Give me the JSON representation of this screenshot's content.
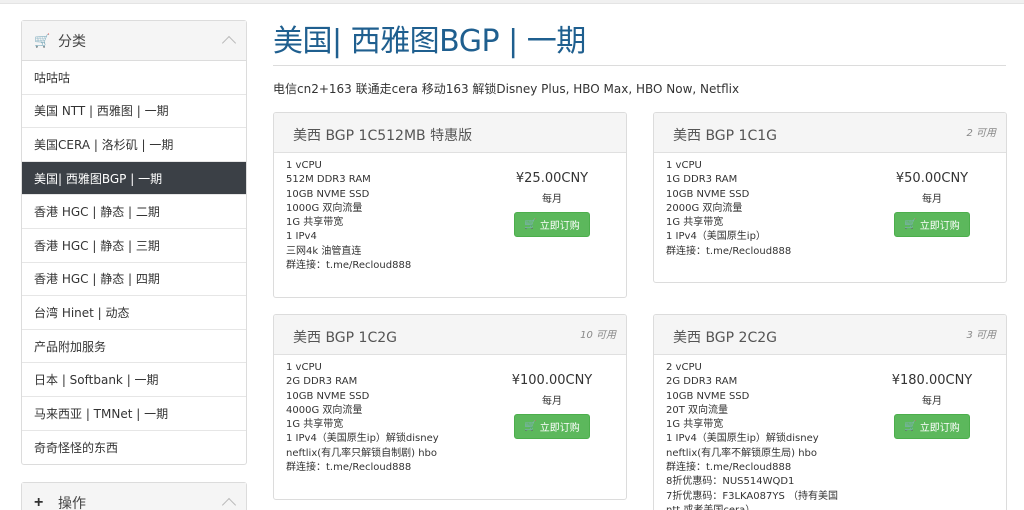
{
  "sidebar": {
    "categories": {
      "title": "分类",
      "items": [
        "咕咕咕",
        "美国 NTT | 西雅图 | 一期",
        "美国CERA | 洛杉矶 | 一期",
        "美国| 西雅图BGP | 一期",
        "香港 HGC | 静态 | 二期",
        "香港 HGC | 静态 | 三期",
        "香港 HGC | 静态 | 四期",
        "台湾 Hinet | 动态",
        "产品附加服务",
        "日本 | Softbank | 一期",
        "马来西亚 | TMNet | 一期",
        "奇奇怪怪的东西"
      ],
      "active_index": 3
    },
    "actions": {
      "title": "操作"
    }
  },
  "page": {
    "title": "美国| 西雅图BGP | 一期",
    "tagline": "电信cn2+163 联通走cera 移动163 解锁Disney Plus, HBO Max, HBO Now, Netflix"
  },
  "products": [
    {
      "name": "美西 BGP 1C512MB 特惠版",
      "availability": "",
      "features": [
        "1 vCPU",
        "512M DDR3 RAM",
        "10GB NVME SSD",
        "1000G 双向流量",
        "1G 共享带宽",
        "1 IPv4",
        "三网4k 油管直连",
        "群连接：t.me/Recloud888"
      ],
      "price": "¥25.00CNY",
      "cycle": "每月",
      "button": "立即订购"
    },
    {
      "name": "美西 BGP 1C1G",
      "availability": "2 可用",
      "features": [
        "1 vCPU",
        "1G DDR3 RAM",
        "10GB NVME SSD",
        "2000G 双向流量",
        "1G 共享带宽",
        "1 IPv4（美国原生ip）",
        "群连接：t.me/Recloud888"
      ],
      "price": "¥50.00CNY",
      "cycle": "每月",
      "button": "立即订购"
    },
    {
      "name": "美西 BGP 1C2G",
      "availability": "10 可用",
      "features": [
        "1 vCPU",
        "2G DDR3 RAM",
        "10GB NVME SSD",
        "4000G 双向流量",
        "1G 共享带宽",
        "1 IPv4（美国原生ip）解锁disney",
        "neftlix(有几率只解锁自制剧) hbo",
        "群连接：t.me/Recloud888"
      ],
      "price": "¥100.00CNY",
      "cycle": "每月",
      "button": "立即订购"
    },
    {
      "name": "美西 BGP 2C2G",
      "availability": "3 可用",
      "features": [
        "2 vCPU",
        "2G DDR3 RAM",
        "10GB NVME SSD",
        "20T 双向流量",
        "1G 共享带宽",
        "1 IPv4（美国原生ip）解锁disney",
        "neftlix(有几率不解锁原生局) hbo",
        "群连接：t.me/Recloud888",
        "8折优惠码：NUS514WQD1",
        "7折优惠码：F3LKA087YS （持有美国",
        "ntt 或者美国cera）"
      ],
      "price": "¥180.00CNY",
      "cycle": "每月",
      "button": "立即订购"
    }
  ],
  "colors": {
    "title": "#1f5f8f",
    "active_bg": "#3b4046",
    "button": "#5cb85c"
  },
  "icons": {
    "categories": "cart-icon",
    "actions": "plus-icon",
    "button": "cart-icon"
  }
}
